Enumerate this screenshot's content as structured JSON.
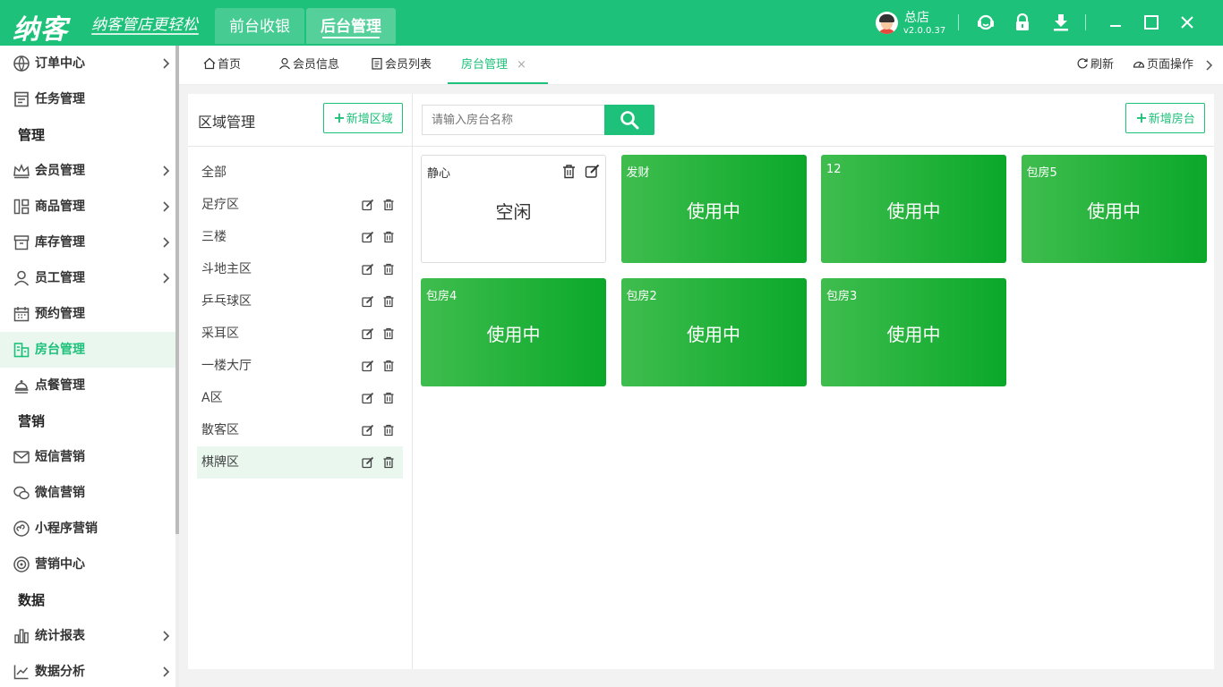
{
  "app": {
    "logo": "纳客",
    "slogan": "纳客管店更轻松",
    "top_tabs": [
      "前台收银",
      "后台管理"
    ],
    "store_name": "总店",
    "version": "v2.0.0.37"
  },
  "sidebar": {
    "items": [
      {
        "label": "订单中心",
        "icon": "globe-icon",
        "arrow": true
      },
      {
        "label": "任务管理",
        "icon": "task-icon",
        "arrow": false
      },
      {
        "group": "管理"
      },
      {
        "label": "会员管理",
        "icon": "crown-icon",
        "arrow": true
      },
      {
        "label": "商品管理",
        "icon": "goods-icon",
        "arrow": true
      },
      {
        "label": "库存管理",
        "icon": "inventory-icon",
        "arrow": true
      },
      {
        "label": "员工管理",
        "icon": "person-icon",
        "arrow": true
      },
      {
        "label": "预约管理",
        "icon": "calendar-icon",
        "arrow": false
      },
      {
        "label": "房台管理",
        "icon": "building-icon",
        "arrow": false,
        "active": true
      },
      {
        "label": "点餐管理",
        "icon": "dish-icon",
        "arrow": false
      },
      {
        "group": "营销"
      },
      {
        "label": "短信营销",
        "icon": "mail-icon",
        "arrow": false
      },
      {
        "label": "微信营销",
        "icon": "wechat-icon",
        "arrow": false
      },
      {
        "label": "小程序营销",
        "icon": "miniprogram-icon",
        "arrow": false
      },
      {
        "label": "营销中心",
        "icon": "target-icon",
        "arrow": false
      },
      {
        "group": "数据"
      },
      {
        "label": "统计报表",
        "icon": "bar-chart-icon",
        "arrow": true
      },
      {
        "label": "数据分析",
        "icon": "line-chart-icon",
        "arrow": true
      }
    ]
  },
  "page_tabs": {
    "home": "首页",
    "member_info": "会员信息",
    "member_list": "会员列表",
    "room_mgmt": "房台管理",
    "close": "×",
    "refresh": "刷新",
    "page_ops": "页面操作"
  },
  "area": {
    "title": "区域管理",
    "add_button": "新增区域",
    "items": [
      "全部",
      "足疗区",
      "三楼",
      "斗地主区",
      "乒乓球区",
      "采耳区",
      "一楼大厅",
      "A区",
      "散客区",
      "棋牌区"
    ],
    "selected": "棋牌区"
  },
  "rooms": {
    "search_placeholder": "请输入房台名称",
    "add_button": "新增房台",
    "cards": [
      {
        "name": "静心",
        "status": "空闲",
        "busy": false
      },
      {
        "name": "发财",
        "status": "使用中",
        "busy": true
      },
      {
        "name": "12",
        "status": "使用中",
        "busy": true
      },
      {
        "name": "包房5",
        "status": "使用中",
        "busy": true
      },
      {
        "name": "包房4",
        "status": "使用中",
        "busy": true
      },
      {
        "name": "包房2",
        "status": "使用中",
        "busy": true
      },
      {
        "name": "包房3",
        "status": "使用中",
        "busy": true
      }
    ]
  },
  "colors": {
    "brand": "#1ec17a",
    "busy_card_start": "#3fbd4e",
    "busy_card_end": "#0aa82a",
    "active_bg": "#e9f7ef"
  }
}
